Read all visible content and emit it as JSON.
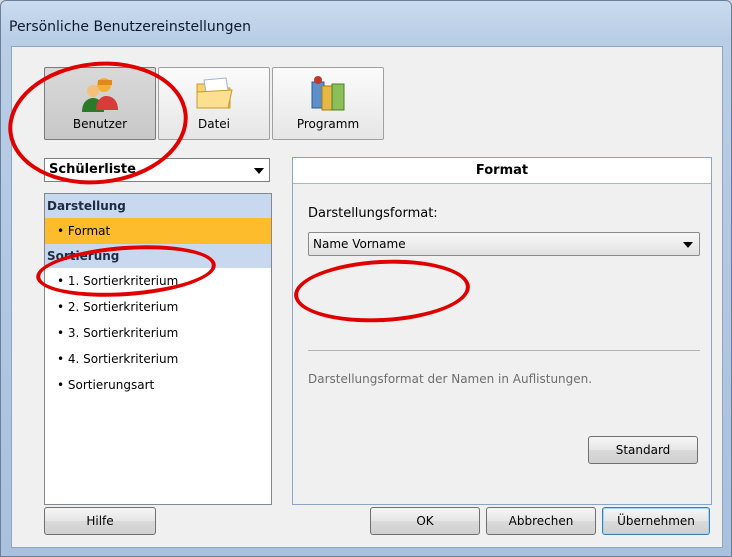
{
  "window": {
    "title": "Persönliche Benutzereinstellungen"
  },
  "nav": {
    "buttons": [
      {
        "label": "Benutzer",
        "icon": "user-icon",
        "selected": true
      },
      {
        "label": "Datei",
        "icon": "folder-icon",
        "selected": false
      },
      {
        "label": "Programm",
        "icon": "program-icon",
        "selected": false
      }
    ]
  },
  "list_combo": {
    "value": "Schülerliste"
  },
  "tree": {
    "groups": [
      {
        "label": "Darstellung",
        "items": [
          "Format"
        ]
      },
      {
        "label": "Sortierung",
        "items": [
          "1. Sortierkriterium",
          "2. Sortierkriterium",
          "3. Sortierkriterium",
          "4. Sortierkriterium",
          "Sortierungsart"
        ]
      }
    ],
    "selected_item": "Format"
  },
  "panel": {
    "header": "Format",
    "field_label": "Darstellungsformat:",
    "field_value": "Name Vorname",
    "description": "Darstellungsformat der Namen in Auflistungen.",
    "standard_button": "Standard"
  },
  "footer": {
    "help": "Hilfe",
    "ok": "OK",
    "cancel": "Abbrechen",
    "apply": "Übernehmen"
  },
  "colors": {
    "annotation_red": "#e00000",
    "selected_item": "#fcbc2b",
    "group_header": "#c8d8ee"
  }
}
